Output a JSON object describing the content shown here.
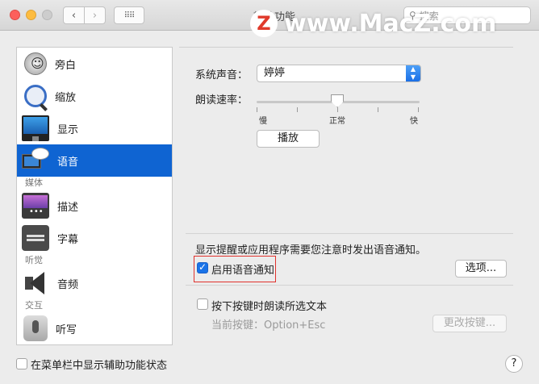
{
  "window": {
    "title": "辅助功能"
  },
  "search": {
    "placeholder": "搜索"
  },
  "watermark": {
    "text": "www.MacZ.com",
    "logo_letter": "Z"
  },
  "sidebar": {
    "items": [
      {
        "label": "旁白",
        "icon": "voiceover-icon"
      },
      {
        "label": "缩放",
        "icon": "zoom-icon"
      },
      {
        "label": "显示",
        "icon": "display-icon"
      },
      {
        "label": "语音",
        "icon": "speech-icon",
        "selected": true
      },
      {
        "group": "媒体"
      },
      {
        "label": "描述",
        "icon": "descriptions-icon"
      },
      {
        "label": "字幕",
        "icon": "captions-icon"
      },
      {
        "group": "听觉"
      },
      {
        "label": "音频",
        "icon": "audio-icon"
      },
      {
        "group": "交互"
      },
      {
        "label": "听写",
        "icon": "dictation-icon"
      }
    ]
  },
  "speech": {
    "voice_label": "系统声音：",
    "voice_value": "婷婷",
    "rate_label": "朗读速率：",
    "rate_slow": "慢",
    "rate_normal": "正常",
    "rate_fast": "快",
    "rate_position": 0.5,
    "play_button": "播放",
    "announce_text": "显示提醒或应用程序需要您注意时发出语音通知。",
    "announce_checkbox": "启用语音通知",
    "announce_checked": true,
    "options_button": "选项...",
    "key_checkbox": "按下按键时朗读所选文本",
    "key_checked": false,
    "current_key_text": "当前按键：Option+Esc",
    "change_key_button": "更改按键..."
  },
  "footer": {
    "menubar_checkbox": "在菜单栏中显示辅助功能状态",
    "menubar_checked": false,
    "help_label": "?"
  },
  "colors": {
    "selection": "#0f64d2",
    "checkbox_checked": "#1a73e8",
    "highlight_box": "#e0322d"
  }
}
